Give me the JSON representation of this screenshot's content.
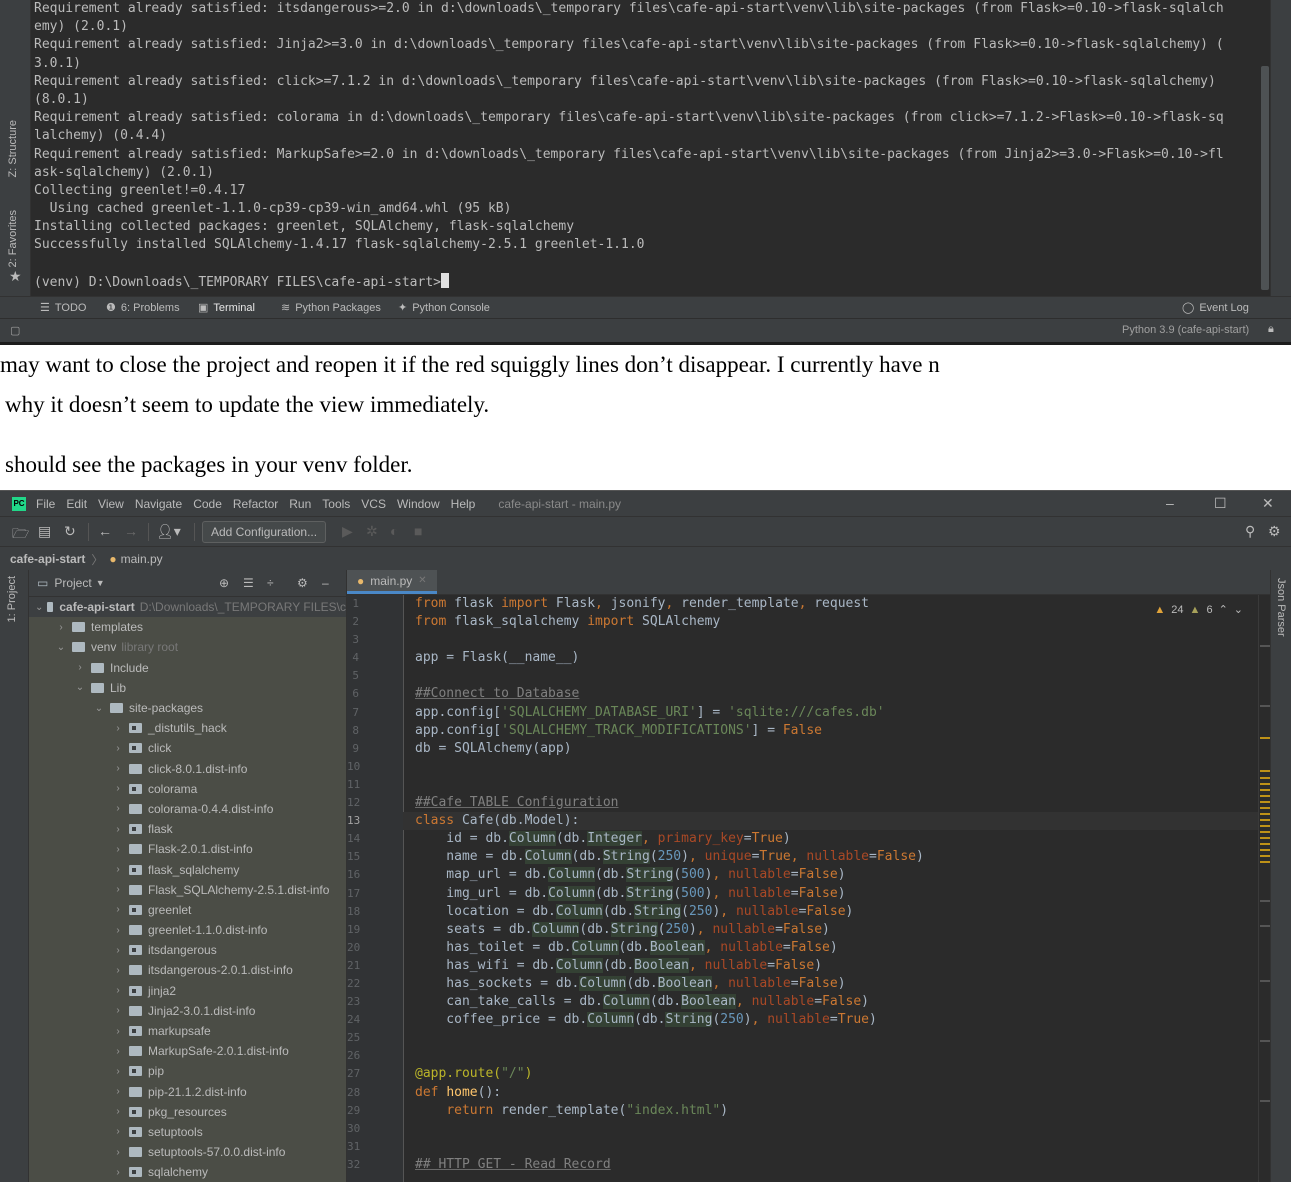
{
  "terminal": {
    "lines": [
      "Requirement already satisfied: itsdangerous>=2.0 in d:\\downloads\\_temporary files\\cafe-api-start\\venv\\lib\\site-packages (from Flask>=0.10->flask-sqlalch",
      "emy) (2.0.1)",
      "Requirement already satisfied: Jinja2>=3.0 in d:\\downloads\\_temporary files\\cafe-api-start\\venv\\lib\\site-packages (from Flask>=0.10->flask-sqlalchemy) (",
      "3.0.1)",
      "Requirement already satisfied: click>=7.1.2 in d:\\downloads\\_temporary files\\cafe-api-start\\venv\\lib\\site-packages (from Flask>=0.10->flask-sqlalchemy)",
      "(8.0.1)",
      "Requirement already satisfied: colorama in d:\\downloads\\_temporary files\\cafe-api-start\\venv\\lib\\site-packages (from click>=7.1.2->Flask>=0.10->flask-sq",
      "lalchemy) (0.4.4)",
      "Requirement already satisfied: MarkupSafe>=2.0 in d:\\downloads\\_temporary files\\cafe-api-start\\venv\\lib\\site-packages (from Jinja2>=3.0->Flask>=0.10->fl",
      "ask-sqlalchemy) (2.0.1)",
      "Collecting greenlet!=0.4.17",
      "  Using cached greenlet-1.1.0-cp39-cp39-win_amd64.whl (95 kB)",
      "Installing collected packages: greenlet, SQLAlchemy, flask-sqlalchemy",
      "Successfully installed SQLAlchemy-1.4.17 flask-sqlalchemy-2.5.1 greenlet-1.1.0",
      ""
    ],
    "prompt": "(venv) D:\\Downloads\\_TEMPORARY FILES\\cafe-api-start>",
    "left_tabs": [
      "Z: Structure",
      "2: Favorites"
    ],
    "tool_tabs": [
      "TODO",
      "6: Problems",
      "Terminal",
      "Python Packages",
      "Python Console"
    ],
    "event_log": "Event Log",
    "interpreter": "Python 3.9 (cafe-api-start)"
  },
  "prose": {
    "line1": "may want to close the project and reopen it if the red squiggly lines don’t disappear. I currently have n",
    "line2": "why it doesn’t seem to update the view immediately.",
    "line3": "should see the packages in your venv folder."
  },
  "ide": {
    "menu": [
      "File",
      "Edit",
      "View",
      "Navigate",
      "Code",
      "Refactor",
      "Run",
      "Tools",
      "VCS",
      "Window",
      "Help"
    ],
    "window_title": "cafe-api-start - main.py",
    "add_config": "Add Configuration...",
    "breadcrumb_project": "cafe-api-start",
    "breadcrumb_file": "main.py",
    "left_tab": "1: Project",
    "right_tab": "Json Parser",
    "project_header": "Project",
    "tree": [
      {
        "label": "cafe-api-start",
        "hint": "D:\\Downloads\\_TEMPORARY FILES\\c",
        "depth": 0,
        "open": true,
        "bold": true
      },
      {
        "label": "templates",
        "depth": 1,
        "open": false
      },
      {
        "label": "venv",
        "hint": "library root",
        "depth": 1,
        "open": true
      },
      {
        "label": "Include",
        "depth": 2,
        "open": false
      },
      {
        "label": "Lib",
        "depth": 2,
        "open": true
      },
      {
        "label": "site-packages",
        "depth": 3,
        "open": true
      },
      {
        "label": "_distutils_hack",
        "depth": 4,
        "open": false,
        "pkg": true
      },
      {
        "label": "click",
        "depth": 4,
        "open": false,
        "pkg": true
      },
      {
        "label": "click-8.0.1.dist-info",
        "depth": 4,
        "open": false
      },
      {
        "label": "colorama",
        "depth": 4,
        "open": false,
        "pkg": true
      },
      {
        "label": "colorama-0.4.4.dist-info",
        "depth": 4,
        "open": false
      },
      {
        "label": "flask",
        "depth": 4,
        "open": false,
        "pkg": true
      },
      {
        "label": "Flask-2.0.1.dist-info",
        "depth": 4,
        "open": false
      },
      {
        "label": "flask_sqlalchemy",
        "depth": 4,
        "open": false,
        "pkg": true
      },
      {
        "label": "Flask_SQLAlchemy-2.5.1.dist-info",
        "depth": 4,
        "open": false
      },
      {
        "label": "greenlet",
        "depth": 4,
        "open": false,
        "pkg": true
      },
      {
        "label": "greenlet-1.1.0.dist-info",
        "depth": 4,
        "open": false
      },
      {
        "label": "itsdangerous",
        "depth": 4,
        "open": false,
        "pkg": true
      },
      {
        "label": "itsdangerous-2.0.1.dist-info",
        "depth": 4,
        "open": false
      },
      {
        "label": "jinja2",
        "depth": 4,
        "open": false,
        "pkg": true
      },
      {
        "label": "Jinja2-3.0.1.dist-info",
        "depth": 4,
        "open": false
      },
      {
        "label": "markupsafe",
        "depth": 4,
        "open": false,
        "pkg": true
      },
      {
        "label": "MarkupSafe-2.0.1.dist-info",
        "depth": 4,
        "open": false
      },
      {
        "label": "pip",
        "depth": 4,
        "open": false,
        "pkg": true
      },
      {
        "label": "pip-21.1.2.dist-info",
        "depth": 4,
        "open": false
      },
      {
        "label": "pkg_resources",
        "depth": 4,
        "open": false,
        "pkg": true
      },
      {
        "label": "setuptools",
        "depth": 4,
        "open": false,
        "pkg": true
      },
      {
        "label": "setuptools-57.0.0.dist-info",
        "depth": 4,
        "open": false
      },
      {
        "label": "sqlalchemy",
        "depth": 4,
        "open": false,
        "pkg": true
      }
    ],
    "editor_tab": "main.py",
    "warnings": "24",
    "weak_warnings": "6",
    "current_line": 13,
    "code": [
      [
        [
          "kw",
          "from "
        ],
        [
          "",
          "flask "
        ],
        [
          "kw",
          "import "
        ],
        [
          "",
          "Flask"
        ],
        [
          "kw",
          ", "
        ],
        [
          "",
          "jsonify"
        ],
        [
          "kw",
          ", "
        ],
        [
          "",
          "render_template"
        ],
        [
          "kw",
          ", "
        ],
        [
          "",
          "request"
        ]
      ],
      [
        [
          "kw",
          "from "
        ],
        [
          "",
          "flask_sqlalchemy "
        ],
        [
          "kw",
          "import "
        ],
        [
          "",
          "SQLAlchemy"
        ]
      ],
      [],
      [
        [
          "",
          "app = Flask(__name__)"
        ]
      ],
      [],
      [
        [
          "cm",
          "##Connect to Database"
        ]
      ],
      [
        [
          "",
          "app.config["
        ],
        [
          "st",
          "'SQLALCHEMY_DATABASE_URI'"
        ],
        [
          "",
          "] = "
        ],
        [
          "st",
          "'sqlite:///cafes.db'"
        ]
      ],
      [
        [
          "",
          "app.config["
        ],
        [
          "st",
          "'SQLALCHEMY_TRACK_MODIFICATIONS'"
        ],
        [
          "",
          "] = "
        ],
        [
          "kw",
          "False"
        ]
      ],
      [
        [
          "",
          "db = SQLAlchemy(app)"
        ]
      ],
      [],
      [],
      [
        [
          "cm",
          "##Cafe TABLE Configuration"
        ]
      ],
      [
        [
          "kw",
          "class "
        ],
        [
          "",
          "Cafe(db.Model):"
        ]
      ],
      [
        [
          "",
          "    id = db."
        ],
        [
          "hl",
          "Column"
        ],
        [
          "",
          "(db."
        ],
        [
          "hl",
          "Integer"
        ],
        [
          "kw",
          ", "
        ],
        [
          "pa",
          "primary_key"
        ],
        [
          "",
          "="
        ],
        [
          "kw",
          "True"
        ],
        [
          "",
          ")"
        ]
      ],
      [
        [
          "",
          "    name = db."
        ],
        [
          "hl",
          "Column"
        ],
        [
          "",
          "(db."
        ],
        [
          "hl",
          "String"
        ],
        [
          "",
          "("
        ],
        [
          "nm",
          "250"
        ],
        [
          "",
          ")"
        ],
        [
          "kw",
          ", "
        ],
        [
          "pa",
          "unique"
        ],
        [
          "",
          "="
        ],
        [
          "kw",
          "True"
        ],
        [
          "kw",
          ", "
        ],
        [
          "pa",
          "nullable"
        ],
        [
          "",
          "="
        ],
        [
          "kw",
          "False"
        ],
        [
          "",
          ")"
        ]
      ],
      [
        [
          "",
          "    map_url = db."
        ],
        [
          "hl",
          "Column"
        ],
        [
          "",
          "(db."
        ],
        [
          "hl",
          "String"
        ],
        [
          "",
          "("
        ],
        [
          "nm",
          "500"
        ],
        [
          "",
          ")"
        ],
        [
          "kw",
          ", "
        ],
        [
          "pa",
          "nullable"
        ],
        [
          "",
          "="
        ],
        [
          "kw",
          "False"
        ],
        [
          "",
          ")"
        ]
      ],
      [
        [
          "",
          "    img_url = db."
        ],
        [
          "hl",
          "Column"
        ],
        [
          "",
          "(db."
        ],
        [
          "hl",
          "String"
        ],
        [
          "",
          "("
        ],
        [
          "nm",
          "500"
        ],
        [
          "",
          ")"
        ],
        [
          "kw",
          ", "
        ],
        [
          "pa",
          "nullable"
        ],
        [
          "",
          "="
        ],
        [
          "kw",
          "False"
        ],
        [
          "",
          ")"
        ]
      ],
      [
        [
          "",
          "    location = db."
        ],
        [
          "hl",
          "Column"
        ],
        [
          "",
          "(db."
        ],
        [
          "hl",
          "String"
        ],
        [
          "",
          "("
        ],
        [
          "nm",
          "250"
        ],
        [
          "",
          ")"
        ],
        [
          "kw",
          ", "
        ],
        [
          "pa",
          "nullable"
        ],
        [
          "",
          "="
        ],
        [
          "kw",
          "False"
        ],
        [
          "",
          ")"
        ]
      ],
      [
        [
          "",
          "    seats = db."
        ],
        [
          "hl",
          "Column"
        ],
        [
          "",
          "(db."
        ],
        [
          "hl",
          "String"
        ],
        [
          "",
          "("
        ],
        [
          "nm",
          "250"
        ],
        [
          "",
          ")"
        ],
        [
          "kw",
          ", "
        ],
        [
          "pa",
          "nullable"
        ],
        [
          "",
          "="
        ],
        [
          "kw",
          "False"
        ],
        [
          "",
          ")"
        ]
      ],
      [
        [
          "",
          "    has_toilet = db."
        ],
        [
          "hl",
          "Column"
        ],
        [
          "",
          "(db."
        ],
        [
          "hl",
          "Boolean"
        ],
        [
          "kw",
          ", "
        ],
        [
          "pa",
          "nullable"
        ],
        [
          "",
          "="
        ],
        [
          "kw",
          "False"
        ],
        [
          "",
          ")"
        ]
      ],
      [
        [
          "",
          "    has_wifi = db."
        ],
        [
          "hl",
          "Column"
        ],
        [
          "",
          "(db."
        ],
        [
          "hl",
          "Boolean"
        ],
        [
          "kw",
          ", "
        ],
        [
          "pa",
          "nullable"
        ],
        [
          "",
          "="
        ],
        [
          "kw",
          "False"
        ],
        [
          "",
          ")"
        ]
      ],
      [
        [
          "",
          "    has_sockets = db."
        ],
        [
          "hl",
          "Column"
        ],
        [
          "",
          "(db."
        ],
        [
          "hl",
          "Boolean"
        ],
        [
          "kw",
          ", "
        ],
        [
          "pa",
          "nullable"
        ],
        [
          "",
          "="
        ],
        [
          "kw",
          "False"
        ],
        [
          "",
          ")"
        ]
      ],
      [
        [
          "",
          "    can_take_calls = db."
        ],
        [
          "hl",
          "Column"
        ],
        [
          "",
          "(db."
        ],
        [
          "hl",
          "Boolean"
        ],
        [
          "kw",
          ", "
        ],
        [
          "pa",
          "nullable"
        ],
        [
          "",
          "="
        ],
        [
          "kw",
          "False"
        ],
        [
          "",
          ")"
        ]
      ],
      [
        [
          "",
          "    coffee_price = db."
        ],
        [
          "hl",
          "Column"
        ],
        [
          "",
          "(db."
        ],
        [
          "hl",
          "String"
        ],
        [
          "",
          "("
        ],
        [
          "nm",
          "250"
        ],
        [
          "",
          ")"
        ],
        [
          "kw",
          ", "
        ],
        [
          "pa",
          "nullable"
        ],
        [
          "",
          "="
        ],
        [
          "kw",
          "True"
        ],
        [
          "",
          ")"
        ]
      ],
      [],
      [],
      [
        [
          "dc",
          "@app.route("
        ],
        [
          "st",
          "\"/\""
        ],
        [
          "dc",
          ")"
        ]
      ],
      [
        [
          "kw",
          "def "
        ],
        [
          "fn",
          "home"
        ],
        [
          "",
          "():"
        ]
      ],
      [
        [
          "",
          "    "
        ],
        [
          "kw",
          "return "
        ],
        [
          "",
          "render_template("
        ],
        [
          "st",
          "\"index.html\""
        ],
        [
          "",
          ")"
        ]
      ],
      [],
      [],
      [
        [
          "cm",
          "## HTTP GET - Read Record"
        ]
      ]
    ]
  }
}
